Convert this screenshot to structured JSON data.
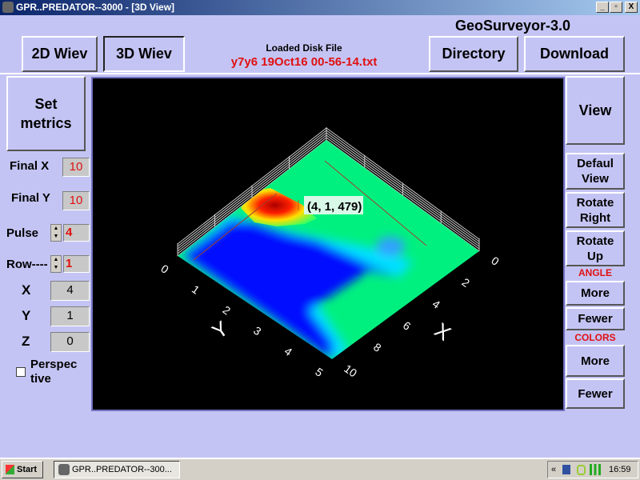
{
  "window": {
    "title": "GPR..PREDATOR--3000 - [3D View]",
    "min": "_",
    "max": "▫",
    "close": "X"
  },
  "header": {
    "app_name": "GeoSurveyor-3.0",
    "loaded_label": "Loaded Disk File",
    "file_name": "y7y6 19Oct16 00-56-14.txt",
    "btn_2d": "2D Wiev",
    "btn_3d": "3D Wiev",
    "btn_directory": "Directory",
    "btn_download": "Download"
  },
  "left": {
    "set_metrics": "Set metrics",
    "final_x_label": "Final X",
    "final_x": "10",
    "final_y_label": "Final Y",
    "final_y": "10",
    "pulse_label": "Pulse",
    "pulse": "4",
    "row_label": "Row----",
    "row": "1",
    "x_label": "X",
    "x": "4",
    "y_label": "Y",
    "y": "1",
    "z_label": "Z",
    "z": "0",
    "perspective": "Perspec tive",
    "perspective_checked": false
  },
  "right": {
    "view": "View",
    "default_view": "Defaul View",
    "rotate_right": "Rotate Right",
    "rotate_up": "Rotate Up",
    "angle": "ANGLE",
    "angle_more": "More",
    "angle_fewer": "Fewer",
    "colors": "COLORS",
    "colors_more": "More",
    "colors_fewer": "Fewer"
  },
  "plot": {
    "tooltip": "(4, 1, 479)",
    "x_axis": "X",
    "y_axis": "Y",
    "x_ticks": [
      "0",
      "2",
      "4",
      "6",
      "8",
      "10"
    ],
    "y_ticks": [
      "0",
      "1",
      "2",
      "3",
      "4",
      "5"
    ],
    "colors": {
      "low": "#0000ff",
      "mid": "#00ff80",
      "high": "#cc0000"
    }
  },
  "taskbar": {
    "start": "Start",
    "task": "GPR..PREDATOR--300...",
    "tray_arrow": "«",
    "clock": "16:59"
  }
}
